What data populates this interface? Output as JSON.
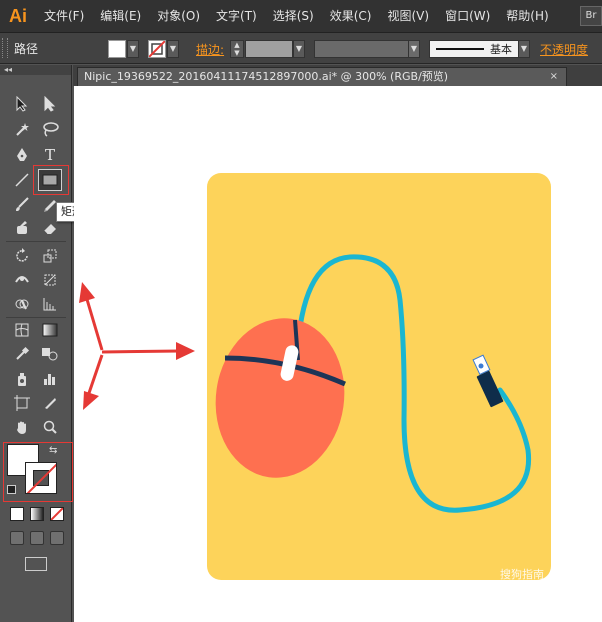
{
  "app": {
    "logo": "Ai",
    "br_button": "Br"
  },
  "menu": [
    "文件(F)",
    "编辑(E)",
    "对象(O)",
    "文字(T)",
    "选择(S)",
    "效果(C)",
    "视图(V)",
    "窗口(W)",
    "帮助(H)"
  ],
  "control_bar": {
    "object_label": "路径",
    "stroke_label": "描边:",
    "brush_label": "基本",
    "opacity_label": "不透明度"
  },
  "toolbox": {
    "collapse": "◂◂"
  },
  "tooltip": "矩形工具 (M)",
  "document": {
    "tab_title": "Nipic_19369522_20160411174512897000.ai* @ 300% (RGB/预览)",
    "close": "×"
  },
  "watermark": "搜狗指南",
  "icons": {
    "tools": [
      "selection-icon",
      "direct-selection-icon",
      "magic-wand-icon",
      "lasso-icon",
      "pen-icon",
      "type-icon",
      "line-segment-icon",
      "rectangle-icon",
      "paintbrush-icon",
      "pencil-icon",
      "blob-brush-icon",
      "eraser-icon",
      "rotate-icon",
      "scale-icon",
      "width-icon",
      "free-transform-icon",
      "shape-builder-icon",
      "perspective-grid-icon",
      "mesh-icon",
      "gradient-icon",
      "eyedropper-icon",
      "blend-icon",
      "symbol-sprayer-icon",
      "column-graph-icon",
      "artboard-icon",
      "slice-icon",
      "hand-icon",
      "zoom-icon"
    ]
  },
  "colors": {
    "artboard": "#fdd35a",
    "mouse_body": "#fe7050",
    "mouse_line": "#1d3557",
    "cable": "#1ab6d1",
    "connector": "#0f2d4a",
    "highlight": "#e53935",
    "accent": "#f7941e"
  }
}
